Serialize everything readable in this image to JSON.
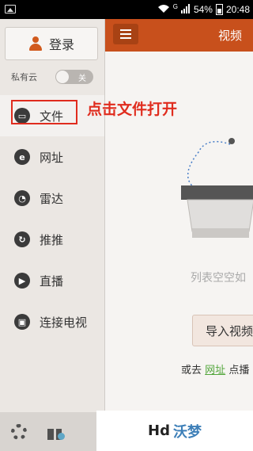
{
  "status_bar": {
    "network": "G",
    "battery": "54%",
    "time": "20:48"
  },
  "sidebar": {
    "login_label": "登录",
    "private_cloud": {
      "label": "私有云",
      "toggle": "关"
    },
    "items": [
      {
        "label": "文件",
        "icon": "folder-icon"
      },
      {
        "label": "网址",
        "icon": "browser-e-icon"
      },
      {
        "label": "雷达",
        "icon": "radar-icon"
      },
      {
        "label": "推推",
        "icon": "share-icon"
      },
      {
        "label": "直播",
        "icon": "live-icon"
      },
      {
        "label": "连接电视",
        "icon": "tv-icon"
      }
    ]
  },
  "annotation": "点击文件打开",
  "main": {
    "title": "视频",
    "empty_text": "列表空空如",
    "import_label": "导入视频",
    "or_prefix": "或去",
    "or_link": "网址",
    "or_suffix": "点播"
  },
  "watermark": {
    "brand": "Hd",
    "name": "沃梦"
  },
  "colors": {
    "accent": "#c8501c",
    "annotation": "#e02c1e",
    "link": "#53a63c"
  }
}
